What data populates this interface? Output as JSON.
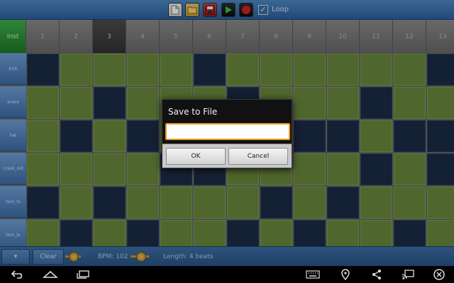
{
  "toolbar": {
    "icons": [
      "new-file-icon",
      "open-folder-icon",
      "save-floppy-icon",
      "play-icon",
      "stop-icon"
    ],
    "loop_checked": true,
    "loop_label": "Loop"
  },
  "grid": {
    "corner_label": "Inst",
    "columns": [
      "1",
      "2",
      "3",
      "4",
      "5",
      "6",
      "7",
      "8",
      "9",
      "10",
      "11",
      "12",
      "13"
    ],
    "active_column": "3",
    "rows": [
      {
        "label": "kick",
        "cells": [
          0,
          1,
          1,
          1,
          1,
          0,
          1,
          1,
          1,
          1,
          1,
          1,
          0
        ]
      },
      {
        "label": "snare",
        "cells": [
          1,
          1,
          0,
          1,
          1,
          1,
          0,
          1,
          1,
          1,
          0,
          1,
          1
        ]
      },
      {
        "label": "hat",
        "cells": [
          1,
          0,
          1,
          0,
          1,
          1,
          1,
          1,
          0,
          0,
          1,
          0,
          0
        ]
      },
      {
        "label": "crash_roll",
        "cells": [
          1,
          1,
          1,
          1,
          0,
          0,
          1,
          1,
          1,
          1,
          0,
          1,
          0
        ]
      },
      {
        "label": "tom_hi",
        "cells": [
          0,
          1,
          0,
          1,
          1,
          1,
          1,
          0,
          1,
          0,
          1,
          1,
          1
        ]
      },
      {
        "label": "tom_lo",
        "cells": [
          1,
          0,
          1,
          0,
          1,
          1,
          0,
          1,
          0,
          1,
          1,
          0,
          1
        ]
      }
    ],
    "colors": {
      "on": "#6a8a3c",
      "off": "#1b2b45"
    }
  },
  "bottom": {
    "arrow_label": "▾",
    "clear_label": "Clear",
    "bpm_text": "BPM: 102",
    "length_text": "Length: 4 beats"
  },
  "navbar": {
    "icons": [
      "back-icon",
      "home-icon",
      "recents-icon",
      "keyboard-icon",
      "location-icon",
      "share-icon",
      "cast-icon",
      "close-icon"
    ]
  },
  "dialog": {
    "title": "Save to File",
    "input_value": "",
    "ok_label": "OK",
    "cancel_label": "Cancel",
    "accent": "#f09a1a"
  }
}
